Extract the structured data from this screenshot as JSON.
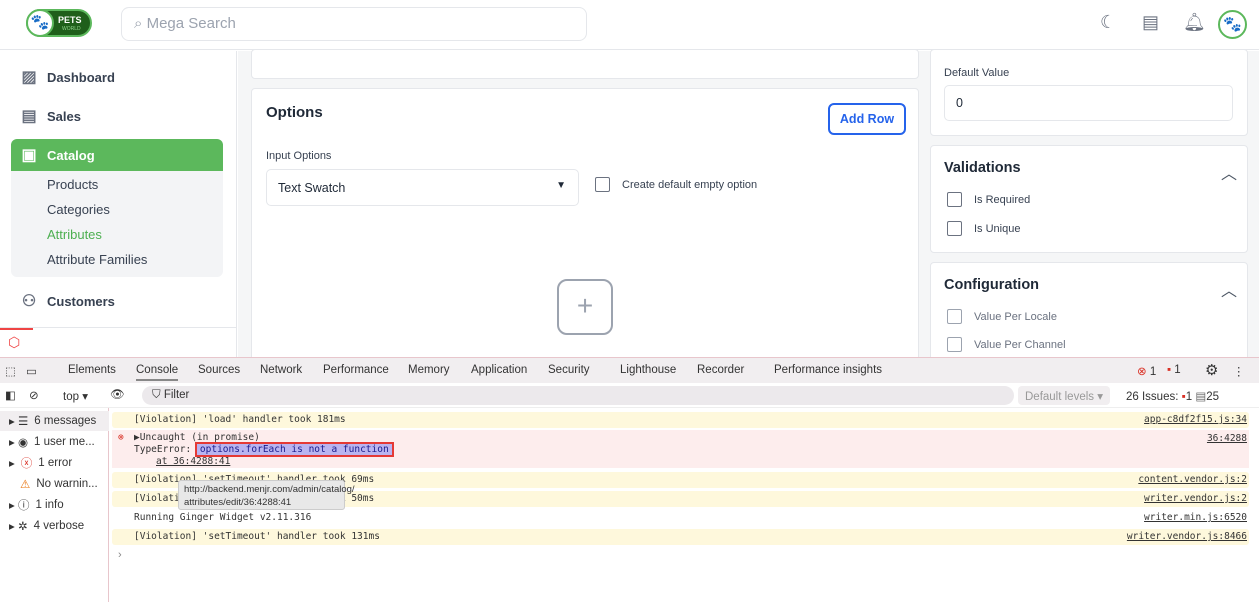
{
  "header": {
    "logo_text": "PETS",
    "logo_subtext": "WORLD",
    "search_placeholder": "Mega Search",
    "icons": [
      "moon-icon",
      "store-icon",
      "bell-icon",
      "avatar-paw-icon"
    ]
  },
  "sidebar": {
    "items": [
      {
        "label": "Dashboard",
        "icon": "dashboard-icon"
      },
      {
        "label": "Sales",
        "icon": "sales-icon"
      },
      {
        "label": "Catalog",
        "icon": "catalog-icon",
        "active": true
      },
      {
        "label": "Customers",
        "icon": "customers-icon"
      }
    ],
    "catalog_sub": [
      {
        "label": "Products"
      },
      {
        "label": "Categories"
      },
      {
        "label": "Attributes",
        "active": true
      },
      {
        "label": "Attribute Families"
      }
    ]
  },
  "options": {
    "title": "Options",
    "add_row": "Add Row",
    "input_options_label": "Input Options",
    "input_options_value": "Text Swatch",
    "create_default_label": "Create default empty option"
  },
  "right": {
    "default_value_label": "Default Value",
    "default_value": "0",
    "validations_title": "Validations",
    "is_required": "Is Required",
    "is_unique": "Is Unique",
    "configuration_title": "Configuration",
    "value_per_locale": "Value Per Locale",
    "value_per_channel": "Value Per Channel"
  },
  "devtools": {
    "tabs": [
      "Elements",
      "Console",
      "Sources",
      "Network",
      "Performance",
      "Memory",
      "Application",
      "Security",
      "Lighthouse",
      "Recorder",
      "Performance insights"
    ],
    "active_tab": "Console",
    "error_count": "1",
    "issue_count": "1",
    "context": "top",
    "filter_placeholder": "Filter",
    "levels": "Default levels",
    "issues_label": "26 Issues:",
    "issues_errors": "1",
    "issues_info": "25",
    "sidebar": [
      "6 messages",
      "1 user me...",
      "1 error",
      "No warnin...",
      "1 info",
      "4 verbose"
    ],
    "messages": [
      {
        "text": "[Violation] 'load' handler took 181ms",
        "source": "app-c8df2f15.js:34",
        "level": "warning"
      },
      {
        "text": "▶Uncaught (in promise)",
        "line2_prefix": "TypeError: ",
        "line2_highlight": "options.forEach is not a function",
        "line3": "at 36:4288:41",
        "source": "36:4288",
        "level": "error"
      },
      {
        "text": "[Violation] 'setTimeout' handler took 69ms",
        "source": "content.vendor.js:2",
        "level": "warning"
      },
      {
        "text": "[Violation] 'setTimeout' handler took 50ms",
        "source": "writer.vendor.js:2",
        "level": "warning"
      },
      {
        "text": "Running Ginger Widget v2.11.316",
        "source": "writer.min.js:6520",
        "level": "info"
      },
      {
        "text": "[Violation] 'setTimeout' handler took 131ms",
        "source": "writer.vendor.js:8466",
        "level": "warning"
      }
    ],
    "tooltip": [
      "http://backend.menjr.com/admin/catalog/",
      "attributes/edit/36:4288:41"
    ]
  }
}
